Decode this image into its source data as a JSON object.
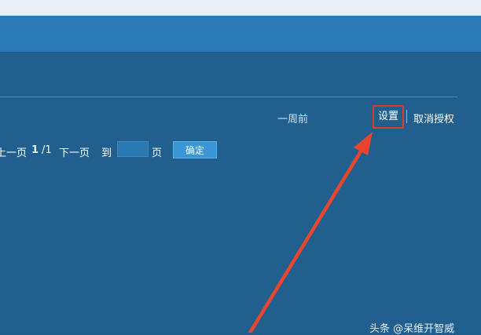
{
  "header": {
    "top_strip_color": "#e8f0f7",
    "nav_color": "#2a7ab8"
  },
  "row": {
    "time_text": "一周前",
    "settings_label": "设置",
    "revoke_label": "取消授权"
  },
  "pager": {
    "prev_label": "上一页",
    "current_page": "1",
    "total_pages": "/1",
    "next_label": "下一页",
    "goto_label": "到",
    "page_input_value": "",
    "page_unit": "页",
    "confirm_label": "确定"
  },
  "annotation": {
    "highlight_color": "#e03a2a",
    "arrow_color": "#e8452f"
  },
  "watermark": {
    "text": "头条 @呆维开智威"
  }
}
